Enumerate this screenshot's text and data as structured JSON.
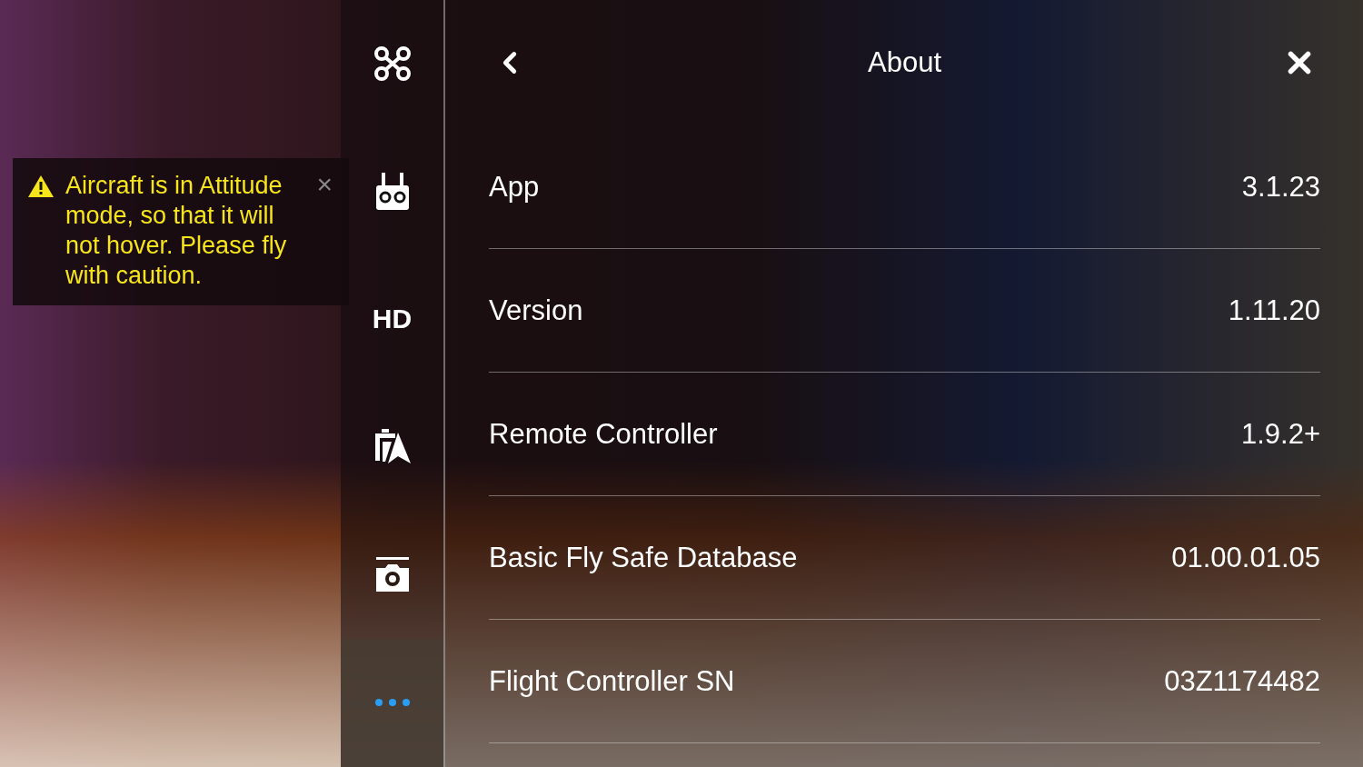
{
  "toast": {
    "message": "Aircraft is in Attitude mode, so that it will not hover. Please fly with caution.",
    "close": "×"
  },
  "sidebar": {
    "items": [
      {
        "kind": "icon",
        "selected": false
      },
      {
        "kind": "icon",
        "selected": false
      },
      {
        "kind": "text",
        "label": "HD",
        "selected": false
      },
      {
        "kind": "icon",
        "selected": false
      },
      {
        "kind": "icon",
        "selected": false
      },
      {
        "kind": "dots",
        "selected": true
      }
    ]
  },
  "panel": {
    "title": "About",
    "rows": [
      {
        "label": "App",
        "value": "3.1.23"
      },
      {
        "label": "Version",
        "value": "1.11.20"
      },
      {
        "label": "Remote Controller",
        "value": "1.9.2+"
      },
      {
        "label": "Basic Fly Safe Database",
        "value": "01.00.01.05"
      },
      {
        "label": "Flight Controller SN",
        "value": "03Z1174482"
      }
    ]
  }
}
